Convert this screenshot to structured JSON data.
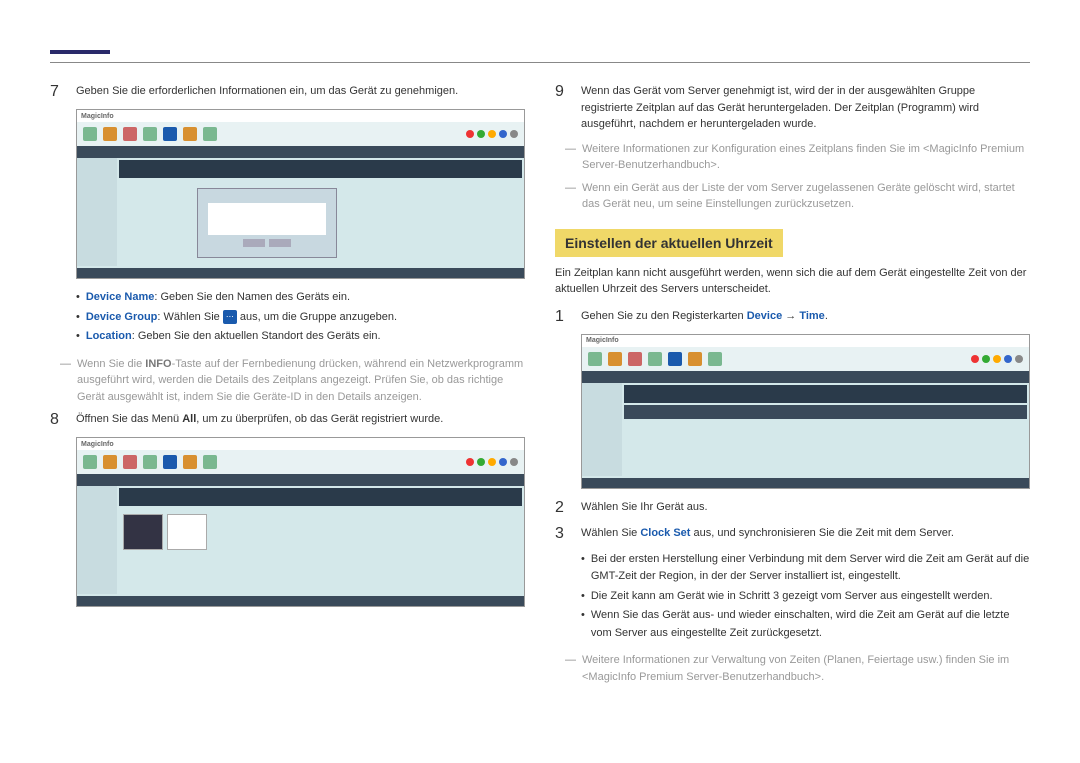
{
  "left": {
    "step7": "Geben Sie die erforderlichen Informationen ein, um das Gerät zu genehmigen.",
    "b_devname_label": "Device Name",
    "b_devname_text": ": Geben Sie den Namen des Geräts ein.",
    "b_devgroup_label": "Device Group",
    "b_devgroup_text1": ": Wählen Sie ",
    "b_devgroup_text2": " aus, um die Gruppe anzugeben.",
    "b_location_label": "Location",
    "b_location_text": ": Geben Sie den aktuellen Standort des Geräts ein.",
    "dash1a": "Wenn Sie die ",
    "dash1b": "INFO",
    "dash1c": "-Taste auf der Fernbedienung drücken, während ein Netzwerkprogramm ausgeführt wird, werden die Details des Zeitplans angezeigt. Prüfen Sie, ob das richtige Gerät ausgewählt ist, indem Sie die Geräte-ID in den Details anzeigen.",
    "step8a": "Öffnen Sie das Menü ",
    "step8b": "All",
    "step8c": ", um zu überprüfen, ob das Gerät registriert wurde."
  },
  "right": {
    "step9": "Wenn das Gerät vom Server genehmigt ist, wird der in der ausgewählten Gruppe registrierte Zeitplan auf das Gerät heruntergeladen. Der Zeitplan (Programm) wird ausgeführt, nachdem er heruntergeladen wurde.",
    "dash1": "Weitere Informationen zur Konfiguration eines Zeitplans finden Sie im <MagicInfo Premium Server-Benutzerhandbuch>.",
    "dash2": "Wenn ein Gerät aus der Liste der vom Server zugelassenen Geräte gelöscht wird, startet das Gerät neu, um seine Einstellungen zurückzusetzen.",
    "heading": "Einstellen der aktuellen Uhrzeit",
    "intro": "Ein Zeitplan kann nicht ausgeführt werden, wenn sich die auf dem Gerät eingestellte Zeit von der aktuellen Uhrzeit des Servers unterscheidet.",
    "step1a": "Gehen Sie zu den Registerkarten ",
    "step1b": "Device",
    "step1c": " → ",
    "step1d": "Time",
    "step1e": ".",
    "step2": "Wählen Sie Ihr Gerät aus.",
    "step3a": "Wählen Sie ",
    "step3b": "Clock Set",
    "step3c": " aus, und synchronisieren Sie die Zeit mit dem Server.",
    "b1": "Bei der ersten Herstellung einer Verbindung mit dem Server wird die Zeit am Gerät auf die GMT-Zeit der Region, in der der Server installiert ist, eingestellt.",
    "b2": "Die Zeit kann am Gerät wie in Schritt 3 gezeigt vom Server aus eingestellt werden.",
    "b3": "Wenn Sie das Gerät aus- und wieder einschalten, wird die Zeit am Gerät auf die letzte vom Server aus eingestellte Zeit zurückgesetzt.",
    "dash3": "Weitere Informationen zur Verwaltung von Zeiten (Planen, Feiertage usw.) finden Sie im <MagicInfo Premium Server-Benutzerhandbuch>."
  },
  "shot": {
    "logo": "MagicInfo"
  }
}
